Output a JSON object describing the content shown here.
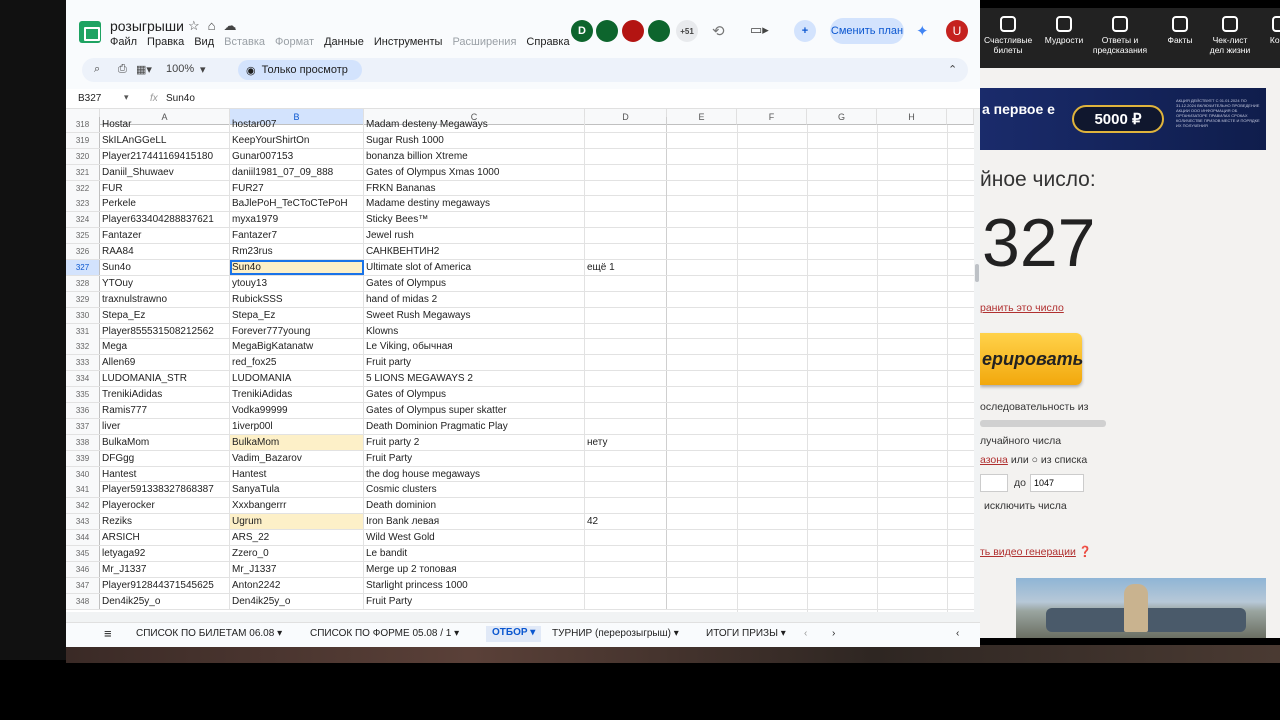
{
  "sheets": {
    "doc_title": "розыгрыши",
    "menu": [
      {
        "label": "Файл",
        "disabled": false
      },
      {
        "label": "Правка",
        "disabled": false
      },
      {
        "label": "Вид",
        "disabled": false
      },
      {
        "label": "Вставка",
        "disabled": true
      },
      {
        "label": "Формат",
        "disabled": true
      },
      {
        "label": "Данные",
        "disabled": false
      },
      {
        "label": "Инструменты",
        "disabled": false
      },
      {
        "label": "Расширения",
        "disabled": true
      },
      {
        "label": "Справка",
        "disabled": false
      }
    ],
    "collaborators": [
      {
        "label": "D",
        "color": "#0d652d"
      },
      {
        "label": "",
        "color": "#0d652d"
      },
      {
        "label": "",
        "color": "#b31412"
      },
      {
        "label": "",
        "color": "#0d652d"
      }
    ],
    "collab_extra": "+51",
    "plan_button": "Сменить план",
    "user_initial": "U",
    "zoom": "100%",
    "view_only": "Только просмотр",
    "cell_ref": "B327",
    "formula_value": "Sun4o",
    "columns": [
      "A",
      "B",
      "C",
      "D",
      "E",
      "F",
      "G",
      "H"
    ],
    "rows": [
      {
        "n": "318",
        "a": "Hostar",
        "b": "hostar007",
        "c": "Madam desteny Megaways",
        "d": "",
        "hl": false
      },
      {
        "n": "319",
        "a": "SkILAnGGeLL",
        "b": "KeepYourShirtOn",
        "c": "Sugar Rush 1000",
        "d": "",
        "hl": false
      },
      {
        "n": "320",
        "a": "Player217441169415180",
        "b": "Gunar007153",
        "c": "bonanza billion Xtreme",
        "d": "",
        "hl": false
      },
      {
        "n": "321",
        "a": " Daniil_Shuwaev",
        "b": " daniil1981_07_09_888",
        "c": "Gates of Olympus Xmas 1000",
        "d": "",
        "hl": false
      },
      {
        "n": "322",
        "a": "FUR",
        "b": "FUR27",
        "c": "FRKN Bananas",
        "d": "",
        "hl": false
      },
      {
        "n": "323",
        "a": "Perkele",
        "b": "BaJlePoH_TeCToCTePoH",
        "c": "Madame destiny megaways",
        "d": "",
        "hl": false
      },
      {
        "n": "324",
        "a": "Player633404288837621",
        "b": "myxa1979",
        "c": "Sticky Bees™",
        "d": "",
        "hl": false
      },
      {
        "n": "325",
        "a": "Fantazer",
        "b": "Fantazer7",
        "c": "Jewel rush",
        "d": "",
        "hl": false
      },
      {
        "n": "326",
        "a": "RAA84",
        "b": "Rm23rus",
        "c": "САНКВЕНТИН2",
        "d": "",
        "hl": false
      },
      {
        "n": "327",
        "a": "Sun4o",
        "b": "Sun4o",
        "c": "Ultimate slot of America",
        "d": "ещё 1",
        "hl": true
      },
      {
        "n": "328",
        "a": "YTOuy",
        "b": "ytouy13",
        "c": "Gates of Olympus",
        "d": "",
        "hl": false
      },
      {
        "n": "329",
        "a": "traxnulstrawno",
        "b": "RubickSSS",
        "c": "hand of midas 2",
        "d": "",
        "hl": false
      },
      {
        "n": "330",
        "a": "Stepa_Ez",
        "b": "Stepa_Ez",
        "c": "Sweet Rush Megaways",
        "d": "",
        "hl": false
      },
      {
        "n": "331",
        "a": "Player855531508212562",
        "b": "Forever777young",
        "c": "Klowns",
        "d": "",
        "hl": false
      },
      {
        "n": "332",
        "a": "Mega",
        "b": "MegaBigKatanatw",
        "c": "Le Viking, обычная",
        "d": "",
        "hl": false
      },
      {
        "n": "333",
        "a": "Allen69",
        "b": "red_fox25",
        "c": "Fruit party",
        "d": "",
        "hl": false
      },
      {
        "n": "334",
        "a": "LUDOMANIA_STR",
        "b": "LUDOMANIA",
        "c": "5 LIONS MEGAWAYS 2",
        "d": "",
        "hl": false
      },
      {
        "n": "335",
        "a": "TrenikiAdidas",
        "b": "TrenikiAdidas",
        "c": "Gates of Olympus",
        "d": "",
        "hl": false
      },
      {
        "n": "336",
        "a": "Ramis777",
        "b": "Vodka99999",
        "c": "Gates of Olympus super skatter",
        "d": "",
        "hl": false
      },
      {
        "n": "337",
        "a": "liver",
        "b": "1iverp00l",
        "c": "Death Dominion Pragmatic Play",
        "d": "",
        "hl": false
      },
      {
        "n": "338",
        "a": "BulkaMom",
        "b": "BulkaMom",
        "c": "Fruit party 2",
        "d": "нету",
        "hl": true
      },
      {
        "n": "339",
        "a": "DFGgg",
        "b": "Vadim_Bazarov",
        "c": "Fruit Party",
        "d": "",
        "hl": false
      },
      {
        "n": "340",
        "a": "Hantest",
        "b": "Hantest",
        "c": "the dog house megaways",
        "d": "",
        "hl": false
      },
      {
        "n": "341",
        "a": "Player591338327868387",
        "b": "SanyaTula",
        "c": "Cosmic clusters",
        "d": "",
        "hl": false
      },
      {
        "n": "342",
        "a": "Playerocker",
        "b": "Xxxbangerrr",
        "c": "Death dominion",
        "d": "",
        "hl": false
      },
      {
        "n": "343",
        "a": "Reziks",
        "b": "Ugrum",
        "c": "Iron Bank    левая",
        "d": "42",
        "hl": true
      },
      {
        "n": "344",
        "a": "ARSICH",
        "b": "ARS_22",
        "c": "Wild West Gold",
        "d": "",
        "hl": false
      },
      {
        "n": "345",
        "a": "letyaga92",
        "b": "Zzero_0",
        "c": "Le bandit",
        "d": "",
        "hl": false
      },
      {
        "n": "346",
        "a": " Mr_J1337",
        "b": " Mr_J1337",
        "c": "Merge up 2 топовая",
        "d": "",
        "hl": false
      },
      {
        "n": "347",
        "a": "Player912844371545625",
        "b": "Anton2242",
        "c": "Starlight princess 1000",
        "d": "",
        "hl": false
      },
      {
        "n": "348",
        "a": "Den4ik25y_o",
        "b": "Den4ik25y_o",
        "c": "Fruit Party",
        "d": "",
        "hl": false
      }
    ],
    "tabs": [
      {
        "label": "СПИСОК ПО БИЛЕТАМ 06.08",
        "active": false
      },
      {
        "label": "СПИСОК ПО ФОРМЕ 05.08 / 1",
        "active": false
      },
      {
        "label": "ОТБОР",
        "active": true
      },
      {
        "label": "ТУРНИР (перерозыгрыш)",
        "active": false
      },
      {
        "label": "ИТОГИ ПРИЗЫ",
        "active": false
      }
    ]
  },
  "right_page": {
    "nav": [
      {
        "label": "Счастливые билеты",
        "icon": "ticket-icon"
      },
      {
        "label": "Мудрости",
        "icon": "book-icon"
      },
      {
        "label": "Ответы и предсказания",
        "icon": "ball-icon"
      },
      {
        "label": "Факты",
        "icon": "alert-icon"
      },
      {
        "label": "Чек-лист дел жизни",
        "icon": "check-icon"
      },
      {
        "label": "Комп",
        "icon": "more-icon"
      }
    ],
    "banner_text": "а первое е",
    "banner_chip": "5000 ₽",
    "banner_fine": "АКЦИЯ ДЕЙСТВУЕТ С 01.01.2024 ПО 31.12.2024 ВКЛЮЧИТЕЛЬНО ПРОВЕДЕНИЕ АКЦИИ ООО ИНФОРМАЦИЯ ОБ ОРГАНИЗАТОРЕ ПРАВИЛАХ СРОКАХ КОЛИЧЕСТВЕ ПРИЗОВ МЕСТЕ И ПОРЯДКЕ ИХ ПОЛУЧЕНИЯ",
    "heading": "йное число:",
    "number": "327",
    "save_link": "ранить это число",
    "generate_button": "ерировать",
    "sequence_text": "оследовательность из",
    "random_text": "лучайного числа",
    "range_link": "азона",
    "or_list": "или",
    "from_list": "из списка",
    "to_label": "до",
    "to_value": "1047",
    "exclude_label": "исключить числа",
    "video_link": "ть видео генерации"
  }
}
